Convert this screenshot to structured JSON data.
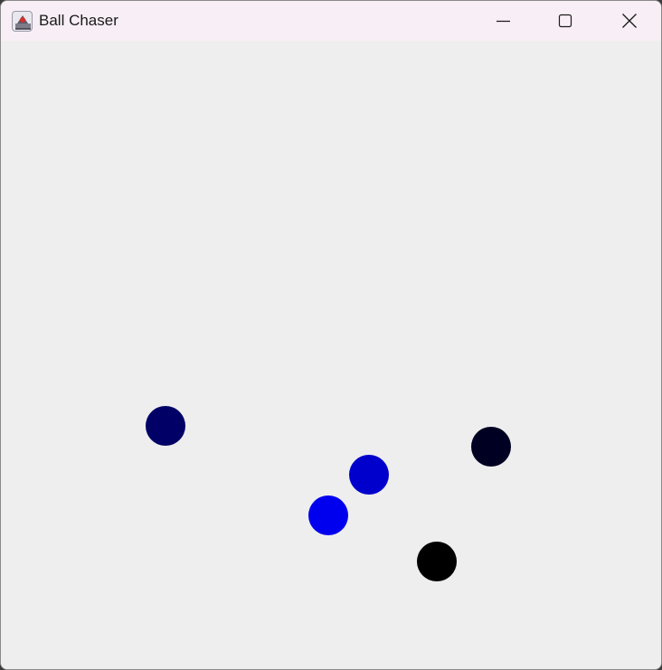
{
  "window": {
    "title": "Ball Chaser",
    "controls": {
      "minimize": "minimize-icon",
      "maximize": "maximize-icon",
      "close": "close-icon"
    }
  },
  "canvas": {
    "background": "#eeeeee",
    "balls": [
      {
        "color": "#000066"
      },
      {
        "color": "#000022"
      },
      {
        "color": "#0000cc"
      },
      {
        "color": "#0000ee"
      },
      {
        "color": "#000000"
      }
    ]
  }
}
